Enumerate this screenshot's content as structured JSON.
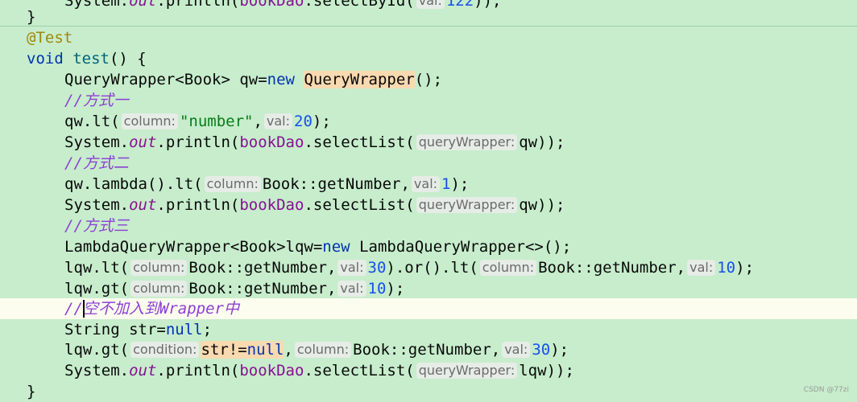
{
  "editor": {
    "l0": {
      "prefix": "System.",
      "out": "out",
      "mid": ".println(",
      "dao": "bookDao",
      "call": ".selectById(",
      "hint": "val:",
      "num": "122",
      "end": "));"
    },
    "l1": {
      "text": "}"
    },
    "l2": {
      "text": "@Test"
    },
    "l3": {
      "kw": "void",
      "fn": "test",
      "rest": "() {"
    },
    "l4": {
      "a": "QueryWrapper<Book> qw=",
      "kw": "new",
      "sp": " ",
      "hl": "QueryWrapper",
      "end": "();"
    },
    "l5": {
      "comment": "//方式一"
    },
    "l6": {
      "a": "qw.lt(",
      "hint1": "column:",
      "str": "\"number\"",
      "comma": ",",
      "hint2": "val:",
      "num": "20",
      "end": ");"
    },
    "l7": {
      "prefix": "System.",
      "out": "out",
      "mid": ".println(",
      "dao": "bookDao",
      "call": ".selectList(",
      "hint": "queryWrapper:",
      "arg": "qw",
      "end": "));"
    },
    "l8": {
      "comment": "//方式二"
    },
    "l9": {
      "a": "qw.lambda().lt(",
      "hint1": "column:",
      "ref": "Book::getNumber,",
      "hint2": "val:",
      "num": "1",
      "end": ");"
    },
    "l10": {
      "prefix": "System.",
      "out": "out",
      "mid": ".println(",
      "dao": "bookDao",
      "call": ".selectList(",
      "hint": "queryWrapper:",
      "arg": "qw",
      "end": "));"
    },
    "l11": {
      "comment": "//方式三"
    },
    "l12": {
      "a": "LambdaQueryWrapper<Book>lqw=",
      "kw": "new",
      "rest": " LambdaQueryWrapper<>();"
    },
    "l13": {
      "a": "lqw.lt(",
      "hint1": "column:",
      "ref1": "Book::getNumber,",
      "hint2": "val:",
      "num1": "30",
      "mid": ").or().lt(",
      "hint3": "column:",
      "ref2": "Book::getNumber,",
      "hint4": "val:",
      "num2": "10",
      "end": ");"
    },
    "l14": {
      "a": "lqw.gt(",
      "hint1": "column:",
      "ref": "Book::getNumber,",
      "hint2": "val:",
      "num": "10",
      "end": ");"
    },
    "l15": {
      "comment": "//空不加入到Wrapper中"
    },
    "l16": {
      "a": "String str=",
      "kw": "null",
      "end": ";"
    },
    "l17": {
      "a": "lqw.gt(",
      "hint1": "condition:",
      "cond_a": "str!=",
      "cond_kw": "null",
      "comma": ",",
      "hint2": "column:",
      "ref": "Book::getNumber,",
      "hint3": "val:",
      "num": "30",
      "end": ");"
    },
    "l18": {
      "prefix": "System.",
      "out": "out",
      "mid": ".println(",
      "dao": "bookDao",
      "call": ".selectList(",
      "hint": "queryWrapper:",
      "arg": "lqw",
      "end": "));"
    },
    "l19": {
      "text": "}"
    }
  },
  "watermark": "CSDN @77zi",
  "colors": {
    "background": "#c7edcc",
    "current_line": "#fdfdef",
    "keyword": "#0033b3",
    "comment": "#8c3fd4",
    "string": "#067d17",
    "number": "#1750eb",
    "annotation": "#9e880d",
    "field": "#871094"
  }
}
